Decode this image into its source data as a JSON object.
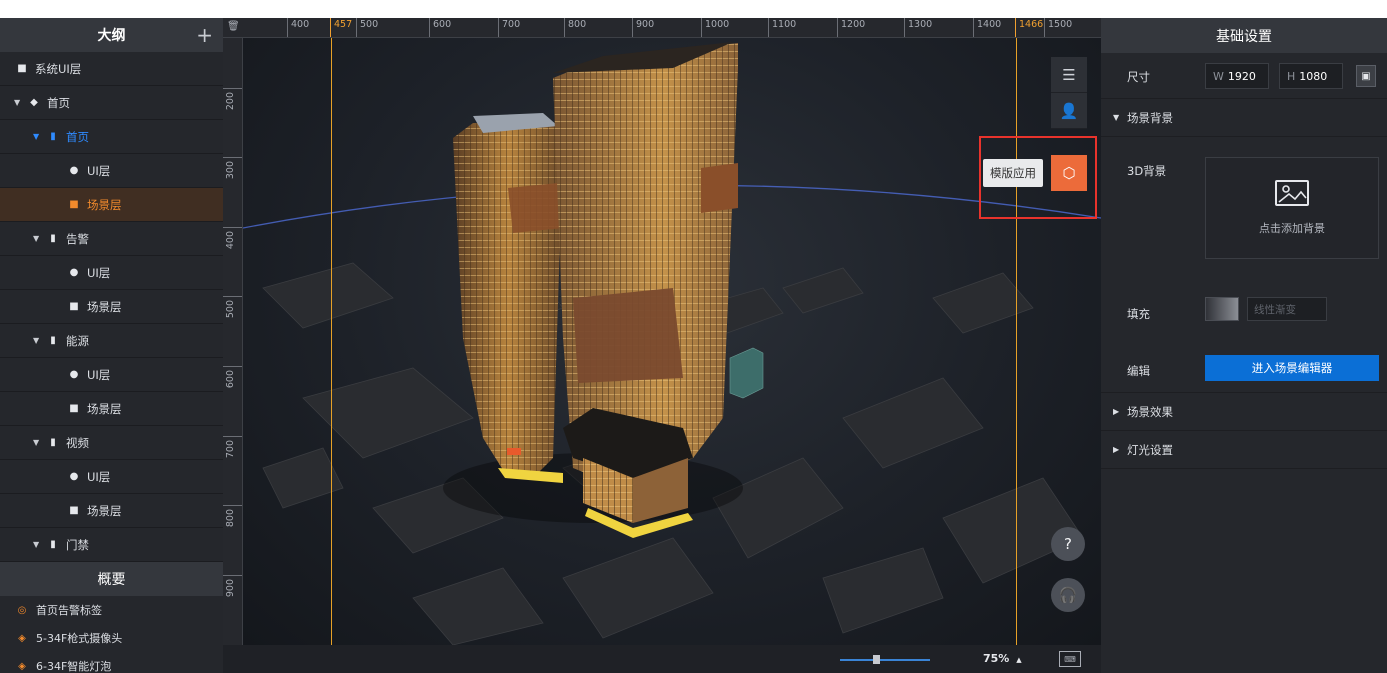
{
  "outline": {
    "title": "大纲",
    "add_label": "+",
    "items": [
      {
        "label": "系统UI层"
      },
      {
        "label": "首页"
      },
      {
        "label": "首页"
      },
      {
        "label": "UI层"
      },
      {
        "label": "场景层"
      },
      {
        "label": "告警"
      },
      {
        "label": "UI层"
      },
      {
        "label": "场景层"
      },
      {
        "label": "能源"
      },
      {
        "label": "UI层"
      },
      {
        "label": "场景层"
      },
      {
        "label": "视频"
      },
      {
        "label": "UI层"
      },
      {
        "label": "场景层"
      },
      {
        "label": "门禁"
      }
    ]
  },
  "overview": {
    "title": "概要",
    "items": [
      {
        "label": "首页告警标签"
      },
      {
        "label": "5-34F枪式摄像头"
      },
      {
        "label": "6-34F智能灯泡"
      }
    ]
  },
  "ruler": {
    "top": [
      "400",
      "457",
      "500",
      "600",
      "700",
      "800",
      "900",
      "1000",
      "1100",
      "1200",
      "1300",
      "1400",
      "1466",
      "1500"
    ],
    "left": [
      "200",
      "300",
      "400",
      "500",
      "600",
      "700",
      "800",
      "900"
    ]
  },
  "canvas": {
    "template_label": "模版应用",
    "help_glyph": "?",
    "zoom": "75%",
    "zoom_caret": "▲",
    "accent_color": "#ec6b3a",
    "guide_color": "#e6a127"
  },
  "settings": {
    "title": "基础设置",
    "size_label": "尺寸",
    "width_prefix": "W",
    "width_value": "1920",
    "height_prefix": "H",
    "height_value": "1080",
    "scene_bg_section": "场景背景",
    "bg3d_label": "3D背景",
    "upload_text": "点击添加背景",
    "fill_label": "填充",
    "fill_placeholder": "线性渐变",
    "edit_label": "编辑",
    "enter_editor": "进入场景编辑器",
    "effects_section": "场景效果",
    "lighting_section": "灯光设置",
    "primary_color": "#0b6fd6"
  }
}
